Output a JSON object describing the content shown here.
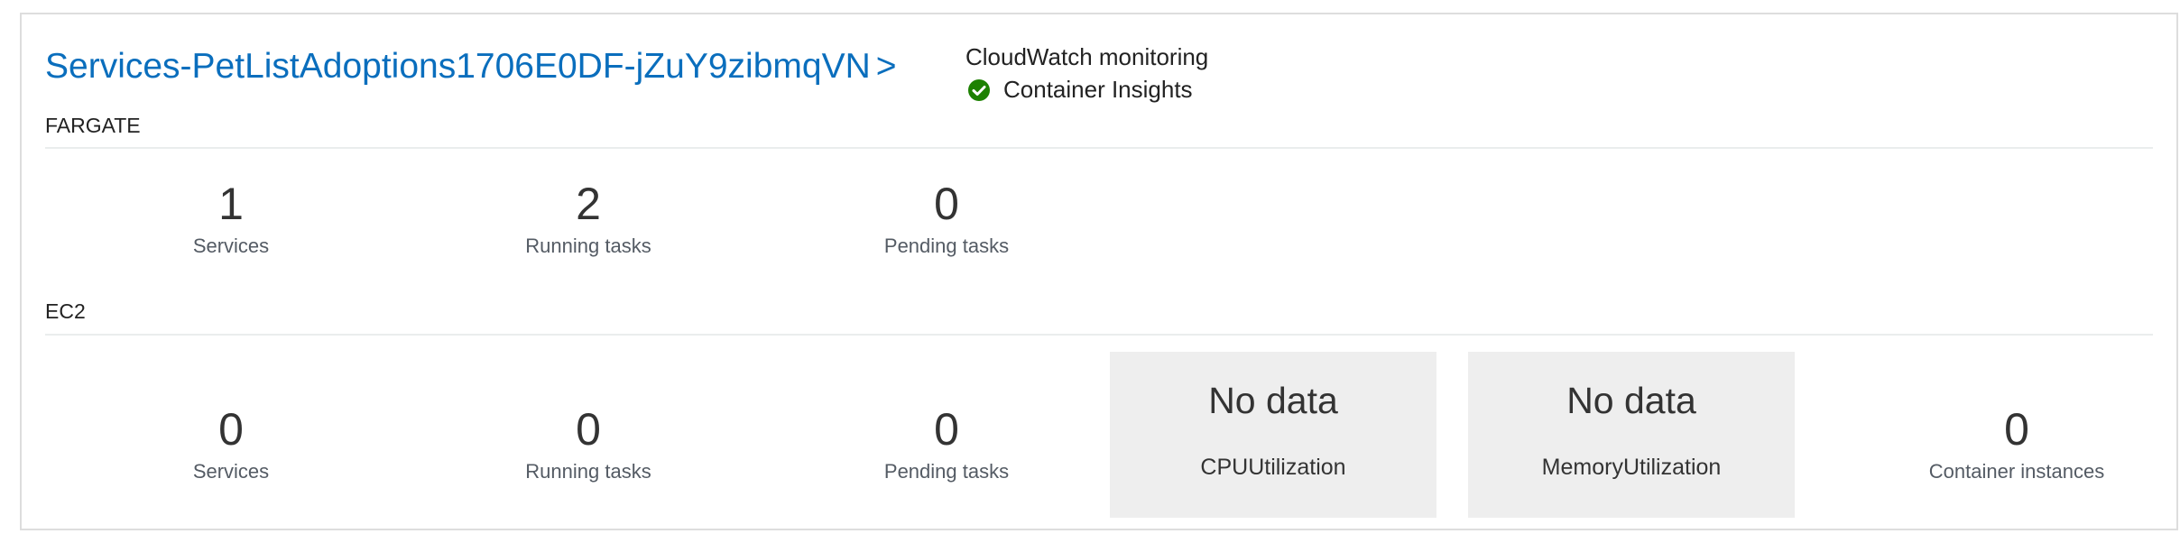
{
  "cluster": {
    "name": "Services-PetListAdoptions1706E0DF-jZuY9zibmqVN",
    "chevron": ">"
  },
  "monitoring": {
    "label": "CloudWatch monitoring",
    "insights_text": "Container Insights",
    "insights_status_icon": "check-circle-icon",
    "status_color": "#1d8102"
  },
  "fargate": {
    "label": "FARGATE",
    "stats": [
      {
        "value": "1",
        "label": "Services"
      },
      {
        "value": "2",
        "label": "Running tasks"
      },
      {
        "value": "0",
        "label": "Pending tasks"
      }
    ]
  },
  "ec2": {
    "label": "EC2",
    "stats": [
      {
        "value": "0",
        "label": "Services"
      },
      {
        "value": "0",
        "label": "Running tasks"
      },
      {
        "value": "0",
        "label": "Pending tasks"
      }
    ],
    "metrics": [
      {
        "value": "No data",
        "label": "CPUUtilization"
      },
      {
        "value": "No data",
        "label": "MemoryUtilization"
      }
    ],
    "container_instances": {
      "value": "0",
      "label": "Container instances"
    }
  },
  "colors": {
    "link": "#0a6ebd",
    "metric_box_bg": "#eeeeee",
    "border": "#dddddd"
  }
}
